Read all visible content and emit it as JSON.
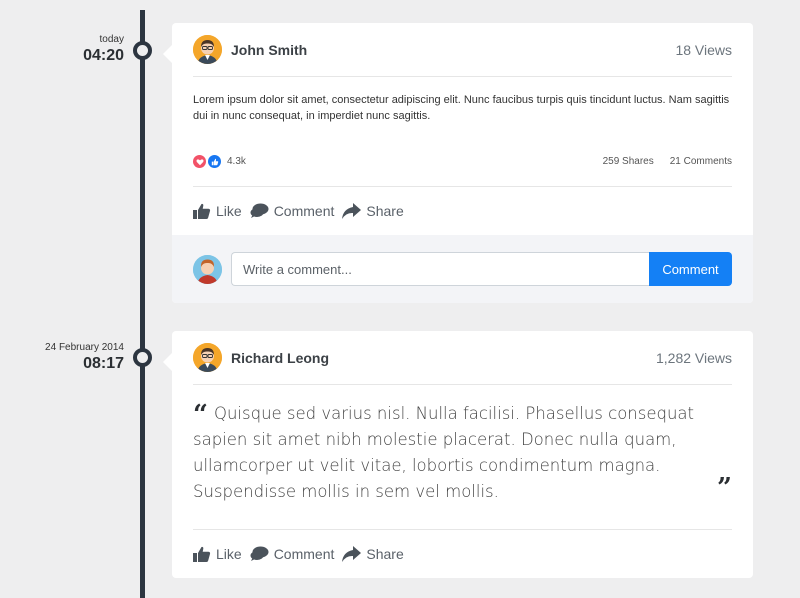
{
  "posts": [
    {
      "date": "today",
      "time": "04:20",
      "author": "John Smith",
      "views": "18 Views",
      "text": "Lorem ipsum dolor sit amet, consectetur adipiscing elit. Nunc faucibus turpis quis tincidunt luctus. Nam sagittis dui in nunc consequat, in imperdiet nunc sagittis.",
      "reactions": "4.3k",
      "shares": "259 Shares",
      "comments": "21 Comments",
      "actions": {
        "like": "Like",
        "comment": "Comment",
        "share": "Share"
      },
      "comment_box": {
        "placeholder": "Write a comment...",
        "button": "Comment"
      }
    },
    {
      "date": "24 February 2014",
      "time": "08:17",
      "author": "Richard Leong",
      "views": "1,282 Views",
      "quote": "Quisque sed varius nisl. Nulla facilisi. Phasellus consequat sapien sit amet nibh molestie placerat. Donec nulla quam, ullamcorper ut velit vitae, lobortis condimentum magna. Suspendisse mollis in sem vel mollis.",
      "actions": {
        "like": "Like",
        "comment": "Comment",
        "share": "Share"
      }
    }
  ],
  "icons": {
    "love": "heart-icon",
    "like": "thumbs-up-icon",
    "comment": "comment-bubble-icon",
    "share": "share-arrow-icon",
    "quote_open": "quote-open-icon",
    "quote_close": "quote-close-icon"
  },
  "colors": {
    "accent": "#1480f5",
    "timeline": "#2c3540",
    "love": "#f25268",
    "like": "#1877f2"
  }
}
